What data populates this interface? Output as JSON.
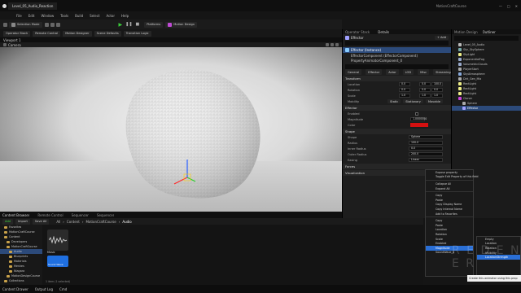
{
  "window": {
    "project_tab": "Level_05_Audio_Reaction",
    "project_name": "MotionCraftCourse"
  },
  "menu": [
    "File",
    "Edit",
    "Window",
    "Tools",
    "Build",
    "Select",
    "Actor",
    "Help"
  ],
  "toolbar": {
    "mode": "Selection Mode",
    "platforms": "Platforms",
    "motion_design": "Motion Design"
  },
  "subbar": {
    "items": [
      "Operator Stack",
      "Remote Control",
      "Motion Designer",
      "Scene Defaults",
      "Transition Logic"
    ]
  },
  "viewport": {
    "tab": "Viewport 1",
    "camera": "Camera"
  },
  "details": {
    "tabs": [
      "Operator Stack",
      "Details"
    ],
    "actor_name": "Effector",
    "component_title": "Effector (Instance)",
    "components": [
      "EffectorComponent (EffectorComponent)",
      "PropertyAnimatorComponent_0"
    ],
    "filter_tabs": [
      "General",
      "Effector",
      "Actor",
      "LOD",
      "Misc",
      "Streaming",
      "All"
    ],
    "active_filter": "All",
    "transform": {
      "location": [
        "0.0",
        "0.0",
        "100.0"
      ],
      "rotation": [
        "0.0",
        "0.0",
        "0.0"
      ],
      "scale": [
        "1.0",
        "1.0",
        "1.0"
      ],
      "mobility": [
        "Static",
        "Stationary",
        "Movable"
      ]
    },
    "sections": [
      "Transform",
      "Effector",
      "Shape",
      "Forces",
      "Visualization"
    ],
    "effector_props": [
      {
        "label": "Enabled",
        "value": ""
      },
      {
        "label": "Magnitude",
        "value": "1.0000000"
      },
      {
        "label": "Color",
        "value": ""
      }
    ],
    "shape_props": [
      {
        "label": "Shape",
        "value": "Sphere"
      },
      {
        "label": "Radius",
        "value": "100.0"
      },
      {
        "label": "Inner Radius",
        "value": "0.0"
      },
      {
        "label": "Outer Radius",
        "value": "200.0"
      },
      {
        "label": "Easing",
        "value": "Linear"
      }
    ],
    "accent_red": "#d41010"
  },
  "outliner": {
    "tabs": [
      "Motion Design",
      "Outliner"
    ],
    "rows": [
      "Level_05_Audio",
      "Sky_SkySphere",
      "SkyLight",
      "ExponentialFog",
      "VolumetricClouds",
      "PlayerStart",
      "SkyAtmosphere",
      "Dirt_Gen_Mix",
      "RectLight",
      "RectLight",
      "RectLight",
      "Cloner",
      "Sphere",
      "Effector"
    ],
    "selected": "Effector"
  },
  "content": {
    "tabs": [
      "Content Browser",
      "Remote Control",
      "Sequencer",
      "Sequencer"
    ],
    "path": [
      "All",
      "Content",
      "MotionCraftCourse",
      "Audio"
    ],
    "buttons": {
      "add": "Add",
      "import": "Import",
      "save_all": "Save All"
    },
    "tree": [
      "Favorites",
      "MotionCraftCourse",
      "Content",
      "Developers",
      "MotionCraftCourse",
      "Audio",
      "Blueprints",
      "Materials",
      "Meshes",
      "Niagara",
      "MotionDesignCourse",
      "Collections"
    ],
    "items": [
      {
        "name": "Music",
        "type": "Sound Wave"
      },
      {
        "name": "Music",
        "type": "Sound Wave"
      }
    ],
    "count": "1 item (1 selected)"
  },
  "context_menu": {
    "items": [
      "Expose property",
      "Toggle Edit Property of this field",
      "Collapse All",
      "Expand All",
      "Copy",
      "Paste",
      "Copy Display Name",
      "Copy Internal Name",
      "Add to Favorites",
      "Copy",
      "Paste",
      "Location",
      "Rotation",
      "Scale",
      "Enabled",
      "Magnitude",
      "SoundWave_0"
    ],
    "highlighted": "Magnitude"
  },
  "submenu": {
    "items": [
      "Empty",
      "Location",
      "Rotation",
      "Visibility",
      "LocationStrength"
    ],
    "highlighted": "LocationStrength"
  },
  "tooltip": "Create this animator using this prop",
  "watermark": "R E D E N E R",
  "status": {
    "left": [
      "Content Drawer",
      "Output Log",
      "Cmd"
    ],
    "right": [
      "Derived Data",
      "Source Control"
    ]
  }
}
